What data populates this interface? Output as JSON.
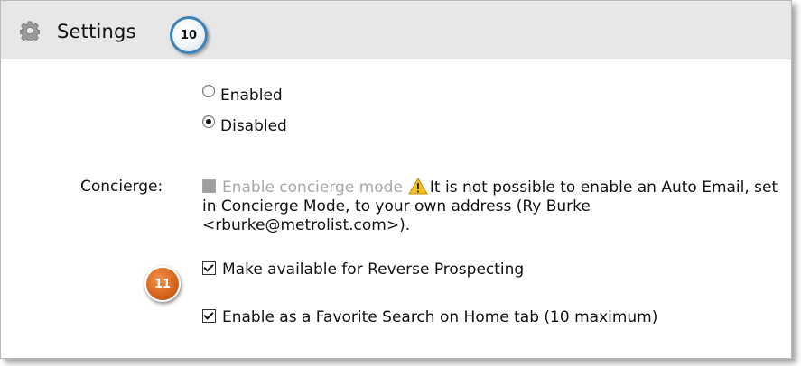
{
  "header": {
    "title": "Settings"
  },
  "callouts": {
    "a": "10",
    "b": "11"
  },
  "status": {
    "options": [
      {
        "label": "Enabled",
        "checked": false
      },
      {
        "label": "Disabled",
        "checked": true
      }
    ]
  },
  "concierge": {
    "label": "Concierge:",
    "checkbox_label": "Enable concierge mode",
    "warning_text": "It is not possible to enable an Auto Email, set in Concierge Mode, to your own address (Ry Burke <rburke@metrolist.com>).",
    "checked": false,
    "disabled": true
  },
  "options": [
    {
      "label": "Make available for Reverse Prospecting",
      "checked": true
    },
    {
      "label": "Enable as a Favorite Search on Home tab (10 maximum)",
      "checked": true
    }
  ],
  "colors": {
    "header_bg": "#e7e7e7",
    "badge_blue": "#3d82b8",
    "badge_orange": "#d9651e",
    "warning": "#f5c21b"
  }
}
